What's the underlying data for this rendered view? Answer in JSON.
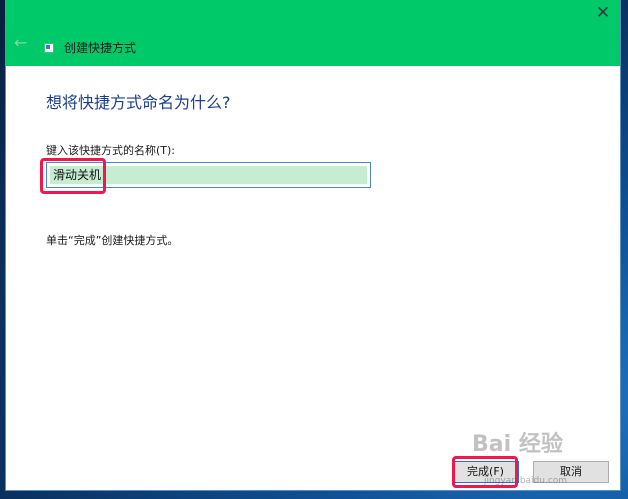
{
  "window": {
    "close_glyph": "✕",
    "back_glyph": "←",
    "title": "创建快捷方式"
  },
  "content": {
    "heading": "想将快捷方式命名为什么?",
    "name_label": "键入该快捷方式的名称(T):",
    "name_value": "滑动关机",
    "hint": "单击“完成”创建快捷方式。"
  },
  "buttons": {
    "finish_label": "完成(F)",
    "cancel_label": "取消"
  },
  "watermark": {
    "logo_text": "Bai 经验",
    "site": "jingyan.baidu.com"
  },
  "colors": {
    "titlebar": "#00c96a",
    "heading": "#1c3f8c",
    "annotation": "#f0174f"
  }
}
